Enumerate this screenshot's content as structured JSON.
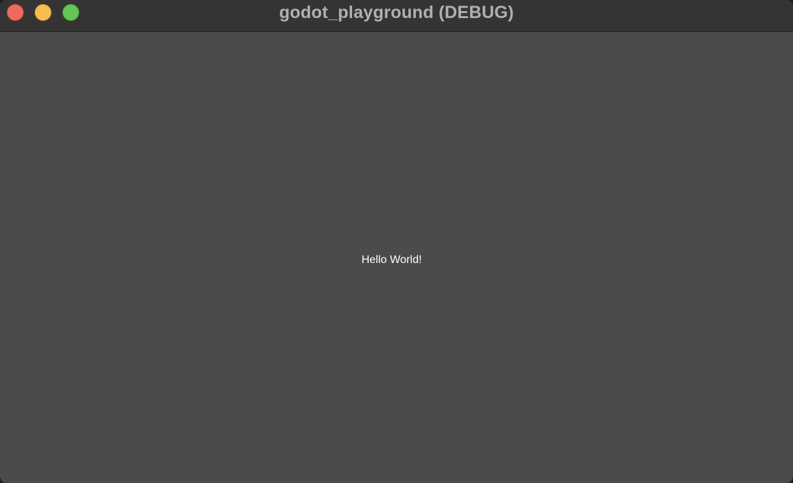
{
  "window": {
    "title": "godot_playground (DEBUG)",
    "controls": {
      "close_color": "#ee6a5f",
      "minimize_color": "#f5be4f",
      "zoom_color": "#62c655"
    }
  },
  "content": {
    "label": "Hello World!",
    "background": "#4b4b4b"
  }
}
